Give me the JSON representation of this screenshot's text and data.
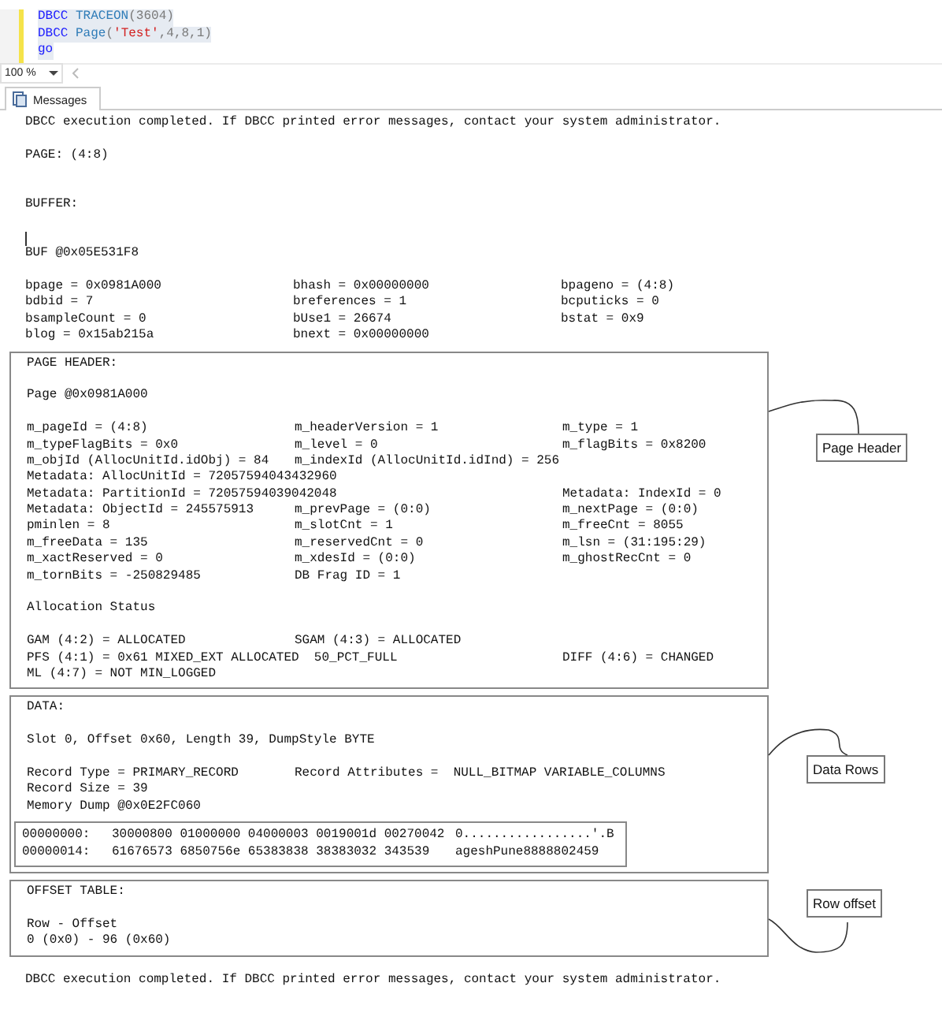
{
  "editor": {
    "lines": [
      [
        {
          "kind": "keyword",
          "text": "DBCC"
        },
        {
          "kind": "function",
          "text": " TRACEON"
        },
        {
          "kind": "plain",
          "text": "(3604)"
        }
      ],
      [
        {
          "kind": "keyword",
          "text": "DBCC"
        },
        {
          "kind": "function",
          "text": " Page"
        },
        {
          "kind": "plain",
          "text": "("
        },
        {
          "kind": "string",
          "text": "'Test'"
        },
        {
          "kind": "plain",
          "text": ",4,8,1)"
        }
      ],
      [
        {
          "kind": "keyword",
          "text": "go"
        }
      ]
    ]
  },
  "zoom": {
    "value": "100 %"
  },
  "results_tabs": [
    {
      "label": "Messages",
      "selected": true
    }
  ],
  "output": [
    {
      "kind": "line",
      "text": "DBCC execution completed. If DBCC printed error messages, contact your system administrator."
    },
    {
      "kind": "blank"
    },
    {
      "kind": "line",
      "text": "PAGE: (4:8)"
    },
    {
      "kind": "blank"
    },
    {
      "kind": "blank"
    },
    {
      "kind": "line",
      "text": "BUFFER:"
    },
    {
      "kind": "blank"
    },
    {
      "kind": "cursor"
    },
    {
      "kind": "line",
      "text": "BUF @0x05E531F8"
    },
    {
      "kind": "blank"
    },
    {
      "kind": "grid",
      "rows": [
        [
          "bpage = 0x0981A000",
          "bhash = 0x00000000",
          "bpageno = (4:8)"
        ],
        [
          "bdbid = 7",
          "breferences = 1",
          "bcputicks = 0"
        ],
        [
          "bsampleCount = 0",
          "bUse1 = 26674",
          "bstat = 0x9"
        ],
        [
          "blog = 0x15ab215a",
          "bnext = 0x00000000",
          null
        ]
      ]
    },
    {
      "kind": "box",
      "annotation": "Page Header",
      "content": [
        {
          "kind": "line",
          "text": "PAGE HEADER:"
        },
        {
          "kind": "blank"
        },
        {
          "kind": "line",
          "text": "Page @0x0981A000"
        },
        {
          "kind": "blank"
        },
        {
          "kind": "grid",
          "rows": [
            [
              "m_pageId = (4:8)",
              "m_headerVersion = 1",
              "m_type = 1"
            ],
            [
              "m_typeFlagBits = 0x0",
              "m_level = 0",
              "m_flagBits = 0x8200"
            ],
            [
              "m_objId (AllocUnitId.idObj) = 84",
              "m_indexId (AllocUnitId.idInd) = 256",
              null
            ],
            [
              "Metadata: AllocUnitId = 72057594043432960",
              null,
              null
            ],
            [
              "Metadata: PartitionId = 72057594039042048",
              null,
              "Metadata: IndexId = 0"
            ],
            [
              "Metadata: ObjectId = 245575913",
              "m_prevPage = (0:0)",
              "m_nextPage = (0:0)"
            ],
            [
              "pminlen = 8",
              "m_slotCnt = 1",
              "m_freeCnt = 8055"
            ],
            [
              "m_freeData = 135",
              "m_reservedCnt = 0",
              "m_lsn = (31:195:29)"
            ],
            [
              "m_xactReserved = 0",
              "m_xdesId = (0:0)",
              "m_ghostRecCnt = 0"
            ],
            [
              "m_tornBits = -250829485",
              "DB Frag ID = 1",
              null
            ]
          ]
        },
        {
          "kind": "blank"
        },
        {
          "kind": "line",
          "text": "Allocation Status"
        },
        {
          "kind": "blank"
        },
        {
          "kind": "grid",
          "rows": [
            [
              "GAM (4:2) = ALLOCATED",
              "SGAM (4:3) = ALLOCATED",
              null
            ],
            [
              "PFS (4:1) = 0x61 MIXED_EXT ALLOCATED  50_PCT_FULL",
              null,
              "DIFF (4:6) = CHANGED"
            ],
            [
              "ML (4:7) = NOT MIN_LOGGED",
              null,
              null
            ]
          ]
        }
      ]
    },
    {
      "kind": "box",
      "annotation": "Data Rows",
      "content": [
        {
          "kind": "line",
          "text": "DATA:"
        },
        {
          "kind": "blank"
        },
        {
          "kind": "line",
          "text": "Slot 0, Offset 0x60, Length 39, DumpStyle BYTE"
        },
        {
          "kind": "blank"
        },
        {
          "kind": "grid",
          "rows": [
            [
              "Record Type = PRIMARY_RECORD",
              "Record Attributes =  NULL_BITMAP VARIABLE_COLUMNS",
              null
            ]
          ]
        },
        {
          "kind": "line",
          "text": "Record Size = 39"
        },
        {
          "kind": "line",
          "text": "Memory Dump @0x0E2FC060"
        },
        {
          "kind": "dump",
          "rows": [
            [
              "00000000:",
              "30000800 01000000 04000003 0019001d 00270042",
              "0.................'.B"
            ],
            [
              "00000014:",
              "61676573 6850756e 65383838 38383032 343539",
              "ageshPune8888802459"
            ]
          ]
        }
      ]
    },
    {
      "kind": "box",
      "annotation": "Row offset",
      "content": [
        {
          "kind": "line",
          "text": "OFFSET TABLE:"
        },
        {
          "kind": "blank"
        },
        {
          "kind": "line",
          "text": "Row - Offset"
        },
        {
          "kind": "line",
          "text": "0 (0x0) - 96 (0x60)"
        }
      ]
    },
    {
      "kind": "blank"
    },
    {
      "kind": "line",
      "text": "DBCC execution completed. If DBCC printed error messages, contact your system administrator."
    }
  ]
}
